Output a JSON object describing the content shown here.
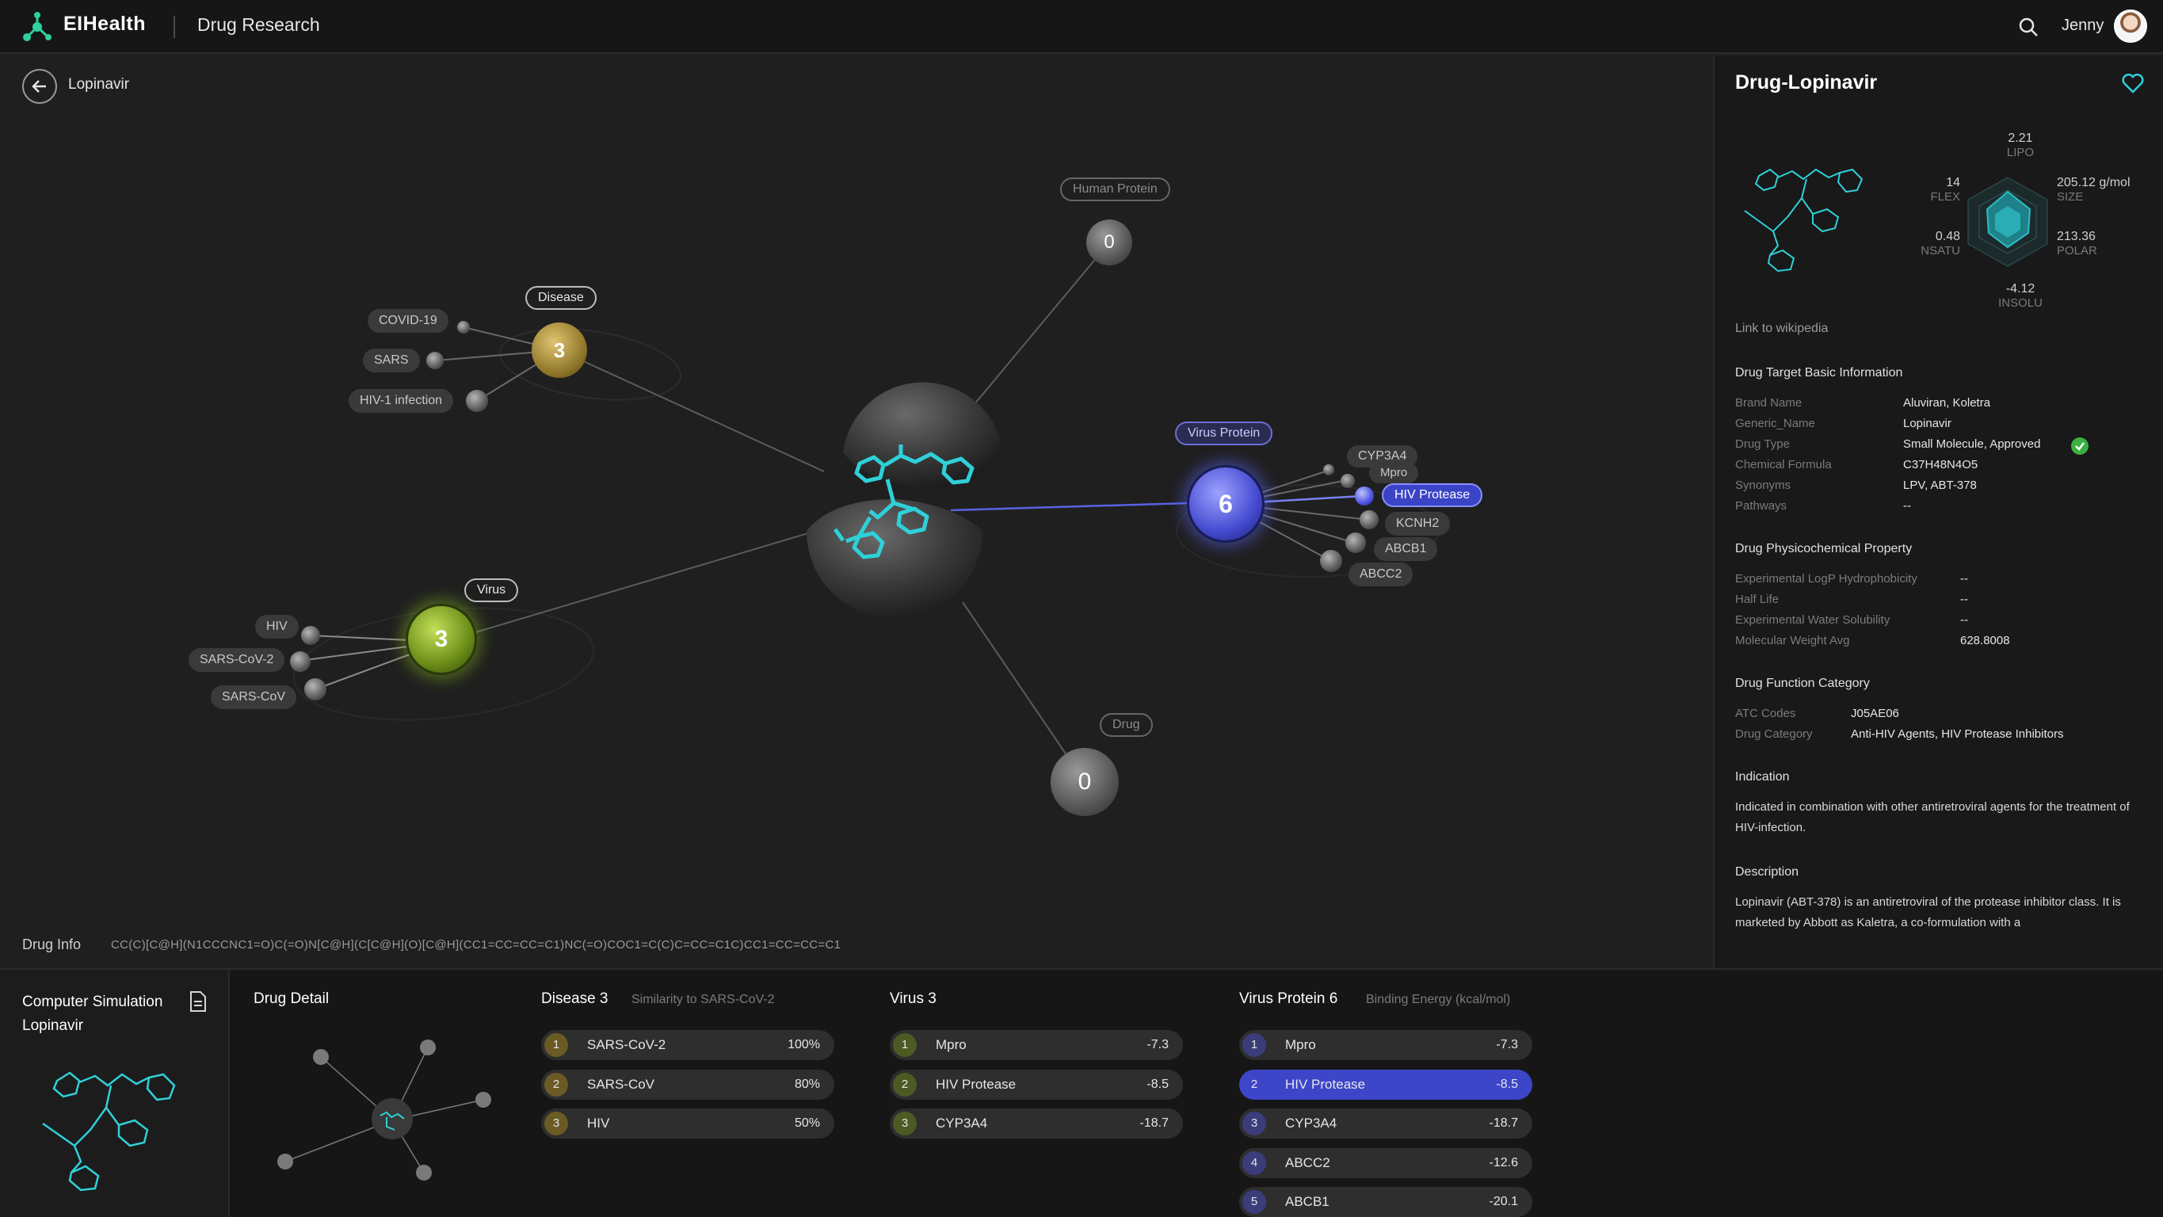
{
  "header": {
    "brand": "EIHealth",
    "section": "Drug Research",
    "user": "Jenny"
  },
  "breadcrumb": {
    "label": "Lopinavir"
  },
  "graph": {
    "disease": {
      "tag": "Disease",
      "count": "3",
      "items": [
        "COVID-19",
        "SARS",
        "HIV-1 infection"
      ]
    },
    "virus": {
      "tag": "Virus",
      "count": "3",
      "items": [
        "HIV",
        "SARS-CoV-2",
        "SARS-CoV"
      ]
    },
    "human_protein": {
      "tag": "Human Protein",
      "count": "0"
    },
    "virus_protein": {
      "tag": "Virus Protein",
      "count": "6",
      "items": [
        "CYP3A4",
        "Mpro",
        "HIV Protease",
        "KCNH2",
        "ABCB1",
        "ABCC2"
      ]
    },
    "drug": {
      "tag": "Drug",
      "count": "0"
    }
  },
  "drug_info": {
    "label": "Drug Info",
    "smiles": "CC(C)[C@H](N1CCCNC1=O)C(=O)N[C@H](C[C@H](O)[C@H](CC1=CC=CC=C1)NC(=O)COC1=C(C)C=CC=C1C)CC1=CC=CC=C1"
  },
  "panel": {
    "title": "Drug-Lopinavir",
    "radar": {
      "lipo": {
        "value": "2.21",
        "label": "LIPO"
      },
      "size": {
        "value": "205.12 g/mol",
        "label": "SIZE"
      },
      "polar": {
        "value": "213.36",
        "label": "POLAR"
      },
      "insolu": {
        "value": "-4.12",
        "label": "INSOLU"
      },
      "nsatu": {
        "value": "0.48",
        "label": "NSATU"
      },
      "flex": {
        "value": "14",
        "label": "FLEX"
      }
    },
    "wiki": "Link to wikipedia",
    "basic_title": "Drug Target Basic Information",
    "basic": [
      {
        "k": "Brand Name",
        "v": "Aluviran, Koletra"
      },
      {
        "k": "Generic_Name",
        "v": "Lopinavir"
      },
      {
        "k": "Drug Type",
        "v": "Small Molecule, Approved"
      },
      {
        "k": "Chemical Formula",
        "v": "C37H48N4O5"
      },
      {
        "k": "Synonyms",
        "v": "LPV, ABT-378"
      },
      {
        "k": "Pathways",
        "v": "--"
      }
    ],
    "phys_title": "Drug Physicochemical Property",
    "phys": [
      {
        "k": "Experimental LogP Hydrophobicity",
        "v": "--"
      },
      {
        "k": "Half Life",
        "v": "--"
      },
      {
        "k": "Experimental Water Solubility",
        "v": "--"
      },
      {
        "k": "Molecular Weight Avg",
        "v": "628.8008"
      }
    ],
    "func_title": "Drug Function Category",
    "func": [
      {
        "k": "ATC Codes",
        "v": "J05AE06"
      },
      {
        "k": "Drug Category",
        "v": "Anti-HIV Agents, HIV Protease Inhibitors"
      }
    ],
    "indication_title": "Indication",
    "indication": "Indicated in combination with other antiretroviral agents for the treatment of HIV-infection.",
    "description_title": "Description",
    "description": "Lopinavir (ABT-378) is an antiretroviral of the protease inhibitor class. It is marketed by Abbott as Kaletra, a co-formulation with a"
  },
  "bottom": {
    "sim_title": "Computer Simulation",
    "sim_drug": "Lopinavir",
    "detail_title": "Drug Detail",
    "disease": {
      "title": "Disease 3",
      "subtitle": "Similarity to SARS-CoV-2",
      "rows": [
        {
          "n": "1",
          "name": "SARS-CoV-2",
          "val": "100%"
        },
        {
          "n": "2",
          "name": "SARS-CoV",
          "val": "80%"
        },
        {
          "n": "3",
          "name": "HIV",
          "val": "50%"
        }
      ]
    },
    "virus": {
      "title": "Virus 3",
      "rows": [
        {
          "n": "1",
          "name": "Mpro",
          "val": "-7.3"
        },
        {
          "n": "2",
          "name": "HIV Protease",
          "val": "-8.5"
        },
        {
          "n": "3",
          "name": "CYP3A4",
          "val": "-18.7"
        }
      ]
    },
    "vprotein": {
      "title": "Virus Protein 6",
      "subtitle": "Binding Energy (kcal/mol)",
      "rows": [
        {
          "n": "1",
          "name": "Mpro",
          "val": "-7.3"
        },
        {
          "n": "2",
          "name": "HIV Protease",
          "val": "-8.5"
        },
        {
          "n": "3",
          "name": "CYP3A4",
          "val": "-18.7"
        },
        {
          "n": "4",
          "name": "ABCC2",
          "val": "-12.6"
        },
        {
          "n": "5",
          "name": "ABCB1",
          "val": "-20.1"
        }
      ]
    }
  },
  "colors": {
    "accent": "#3d46c8",
    "molecule": "#2fd0d8",
    "disease": "#a38a3a",
    "virus": "#8db42a"
  }
}
